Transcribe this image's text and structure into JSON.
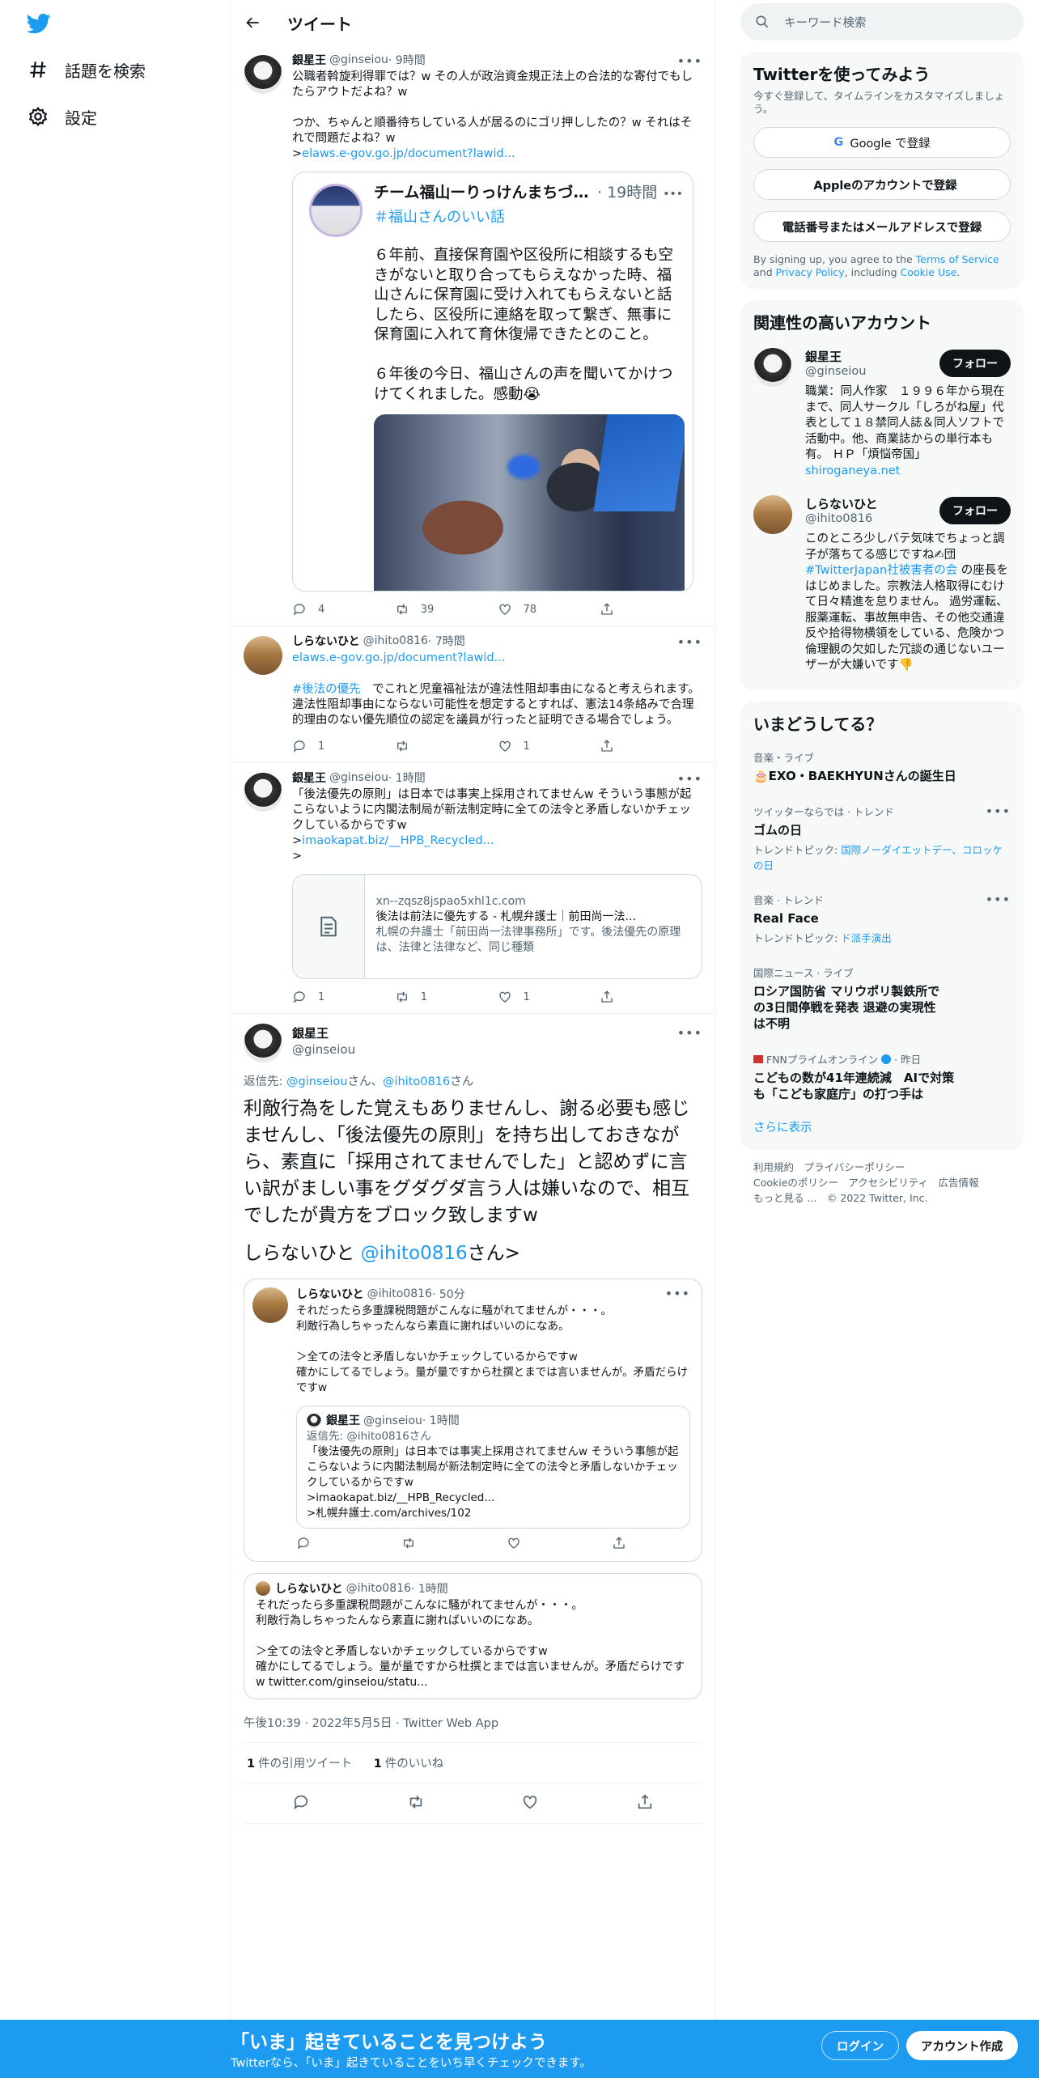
{
  "nav": {
    "explore": "話題を検索",
    "settings": "設定"
  },
  "header": {
    "title": "ツイート"
  },
  "tweets": [
    {
      "name": "銀星王",
      "handle": "@ginseiou",
      "time": "· 9時間",
      "body": "公職者斡旋利得罪では？w その人が政治資金規正法上の合法的な寄付でもしたらアウトだよね？w\n\nつか、ちゃんと順番待ちしている人が居るのにゴリ押ししたの？w それはそれで問題だよね？w\n>",
      "link": "elaws.e-gov.go.jp/document?lawid...",
      "quote": {
        "name": "チーム福山ーりっけんまちづく...",
        "time": "· 19時間",
        "tag": "＃福山さんのいい話",
        "body": "６年前、直接保育園や区役所に相談するも空きがないと取り合ってもらえなかった時、福山さんに保育園に受け入れてもらえないと話したら、区役所に連絡を取って繋ぎ、無事に保育園に入れて育休復帰できたとのこと。\n\n６年後の今日、福山さんの声を聞いてかけつけてくれました。感動😭"
      },
      "replies": "4",
      "retweets": "39",
      "likes": "78"
    },
    {
      "name": "しらないひと",
      "handle": "@ihito0816",
      "time": "· 7時間",
      "link": "elaws.e-gov.go.jp/document?lawid...",
      "hashtag": "#後法の優先",
      "body": "　でこれと児童福祉法が違法性阻却事由になると考えられます。\n違法性阻却事由にならない可能性を想定するとすれば、憲法14条絡みで合理的理由のない優先順位の認定を議員が行ったと証明できる場合でしょう。",
      "replies": "1",
      "retweets": "",
      "likes": "1"
    },
    {
      "name": "銀星王",
      "handle": "@ginseiou",
      "time": "· 1時間",
      "body": "「後法優先の原則」は日本では事実上採用されてませんw そういう事態が起こらないように内閣法制局が新法制定時に全ての法令と矛盾しないかチェックしているからですw\n>",
      "link": "imaokapat.biz/__HPB_Recycled...",
      "tail": "\n>",
      "card": {
        "domain": "xn--zqsz8jspao5xhl1c.com",
        "title": "後法は前法に優先する - 札幌弁護士｜前田尚一法...",
        "desc": "札幌の弁護士「前田尚一法律事務所」です。後法優先の原理は、法律と法律など、同じ種類"
      },
      "replies": "1",
      "retweets": "1",
      "likes": "1"
    }
  ],
  "focus": {
    "name": "銀星王",
    "handle": "@ginseiou",
    "reply_prefix": "返信先: ",
    "reply_to1": "@ginseiou",
    "reply_mid": "さん、",
    "reply_to2": "@ihito0816",
    "reply_suffix": "さん",
    "body": "利敵行為をした覚えもありませんし、謝る必要も感じませんし、「後法優先の原則」を持ち出しておきながら、素直に「採用されてませんでした」と認めずに言い訳がましい事をグダグダ言う人は嫌いなので、相互でしたが貴方をブロック致しますw",
    "mention_prefix": "しらないひと ",
    "mention": "@ihito0816",
    "mention_suffix": "さん>",
    "quote1": {
      "name": "しらないひと",
      "handle": "@ihito0816",
      "time": "· 50分",
      "body": "それだったら多重課税問題がこんなに騒がれてませんが・・・。\n利敵行為しちゃったんなら素直に謝ればいいのになあ。\n\n＞全ての法令と矛盾しないかチェックしているからですw\n確かにしてるでしょう。量が量ですから杜撰とまでは言いませんが。矛盾だらけですw",
      "nested": {
        "name": "銀星王",
        "handle": "@ginseiou",
        "time": "· 1時間",
        "reply": "返信先: @ihito0816さん",
        "body": "「後法優先の原則」は日本では事実上採用されてませんw そういう事態が起こらないように内閣法制局が新法制定時に全ての法令と矛盾しないかチェックしているからですw\n>imaokapat.biz/__HPB_Recycled...\n>札幌弁護士.com/archives/102"
      }
    },
    "quote2": {
      "name": "しらないひと",
      "handle": "@ihito0816",
      "time": "· 1時間",
      "body": "それだったら多重課税問題がこんなに騒がれてませんが・・・。\n利敵行為しちゃったんなら素直に謝ればいいのになあ。\n\n＞全ての法令と矛盾しないかチェックしているからですw\n確かにしてるでしょう。量が量ですから杜撰とまでは言いませんが。矛盾だらけですw twitter.com/ginseiou/statu..."
    },
    "meta": "午後10:39 · 2022年5月5日 · Twitter Web App",
    "quote_count": "1",
    "quote_label": "件の引用ツイート",
    "like_count": "1",
    "like_label": "件のいいね"
  },
  "right": {
    "search_placeholder": "キーワード検索",
    "join": {
      "title": "Twitterを使ってみよう",
      "sub": "今すぐ登録して、タイムラインをカスタマイズしましょう。",
      "google": "Google で登録",
      "apple": "Appleのアカウントで登録",
      "phone": "電話番号またはメールアドレスで登録",
      "fine1": "By signing up, you agree to the ",
      "tos": "Terms of Service",
      "fine2": " and ",
      "privacy": "Privacy Policy",
      "fine3": ", including ",
      "cookie": "Cookie Use",
      "fine4": "."
    },
    "related": {
      "title": "関連性の高いアカウント",
      "follow": "フォロー",
      "accounts": [
        {
          "name": "銀星王",
          "handle": "@ginseiou",
          "bio": "職業：同人作家　１９９６年から現在まで、同人サークル「しろがね屋」代表として１８禁同人誌＆同人ソフトで活動中。他、商業誌からの単行本も有。 ＨＰ「煩悩帝国」",
          "link": "shiroganeya.net"
        },
        {
          "name": "しらないひと",
          "handle": "@ihito0816",
          "bio1": "このところ少しバテ気味でちょっと調子が落ちてる感じですね✍団",
          "bio_link": "#TwitterJapan社被害者の会",
          "bio2": " の座長をはじめました。宗教法人格取得にむけて日々精進を怠りません。 過労運転、服薬運転、事故無申告、その他交通違反や拾得物横領をしている、危険かつ倫理観の欠如した冗談の通じないユーザーが大嫌いです👎"
        }
      ]
    },
    "trends": {
      "title": "いまどうしてる？",
      "items": [
        {
          "cat": "音楽・ライブ",
          "title": "🎂EXO・BAEKHYUNさんの誕生日"
        },
        {
          "cat": "ツイッターならでは · トレンド",
          "title": "ゴムの日",
          "sub_prefix": "トレンドトピック: ",
          "sub_link": "国際ノーダイエットデー、コロッケの日"
        },
        {
          "cat": "音楽 · トレンド",
          "title": "Real Face",
          "sub_prefix": "トレンドトピック: ",
          "sub_link": "ド派手演出"
        },
        {
          "cat": "国際ニュース · ライブ",
          "title": "ロシア国防省 マリウポリ製鉄所での3日間停戦を発表 退避の実現性は不明"
        },
        {
          "cat_source": "FNNプライムオンライン",
          "cat_time": "· 昨日",
          "title": "こどもの数が41年連続減　AIで対策も「こども家庭庁」の打つ手は"
        }
      ],
      "more": "さらに表示"
    },
    "footer": {
      "l1": "利用規約　プライバシーポリシー",
      "l2": "Cookieのポリシー　アクセシビリティ　広告情報",
      "l3": "もっと見る ...　© 2022 Twitter, Inc."
    }
  },
  "bottom": {
    "headline": "「いま」起きていることを見つけよう",
    "sub": "Twitterなら、「いま」起きていることをいち早くチェックできます。",
    "login": "ログイン",
    "signup": "アカウント作成"
  }
}
